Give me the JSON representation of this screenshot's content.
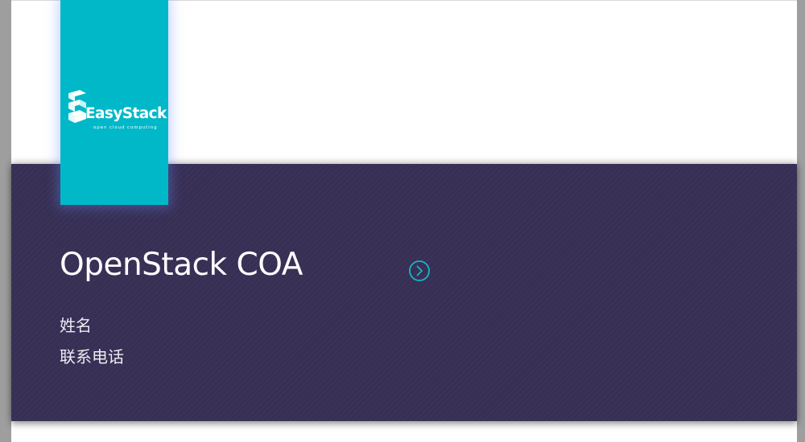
{
  "logo": {
    "name": "EasyStack",
    "tagline": "open cloud computing",
    "background_color": "#00b8c8"
  },
  "hero": {
    "title": "OpenStack COA",
    "background_color": "#372f54",
    "fields": {
      "name_label": "姓名",
      "phone_label": "联系电话"
    },
    "next_button": {
      "icon": "chevron-right-circle-icon",
      "color": "#1ab4c8"
    }
  }
}
